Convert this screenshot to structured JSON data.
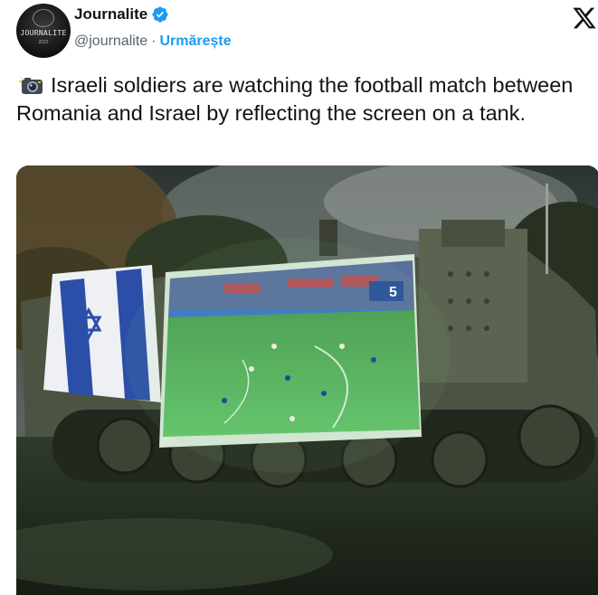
{
  "tweet": {
    "author_name": "Journalite",
    "handle": "@journalite",
    "separator": "·",
    "follow_label": "Urmărește",
    "text": "Israeli soldiers are watching the football match between Romania and Israel by reflecting the screen on a tank.",
    "avatar": {
      "brand": "JOURNALITE",
      "year": "2022"
    }
  },
  "icons": {
    "verified": "verified-badge-icon",
    "platform": "x-logo-icon",
    "camera": "camera-flash-emoji"
  },
  "colors": {
    "accent": "#1d9bf0",
    "text": "#0f1419",
    "secondary": "#536471"
  },
  "media": {
    "description_visible": false,
    "broadcast_overlay": {
      "score_box": "5"
    }
  }
}
